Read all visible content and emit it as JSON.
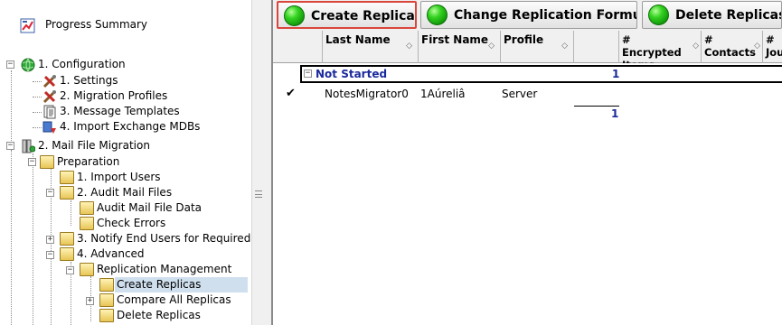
{
  "tree": {
    "progress_summary": "Progress Summary",
    "configuration": "1. Configuration",
    "settings": "1. Settings",
    "migration_profiles": "2. Migration Profiles",
    "message_templates": "3. Message Templates",
    "import_exchange_mdbs": "4. Import Exchange MDBs",
    "mail_file_migration": "2. Mail File Migration",
    "preparation": "Preparation",
    "import_users": "1. Import Users",
    "audit_mail_files": "2. Audit Mail Files",
    "audit_mail_file_data": "Audit Mail File Data",
    "check_errors": "Check Errors",
    "notify_end_users": "3. Notify End Users for Required",
    "advanced": "4. Advanced",
    "replication_management": "Replication Management",
    "create_replicas": "Create Replicas",
    "compare_all_replicas": "Compare All Replicas",
    "delete_replicas": "Delete Replicas"
  },
  "toolbar": {
    "create_replicas": "Create Replicas",
    "change_formula": "Change Replication Formula",
    "delete_replicas": "Delete Replicas"
  },
  "grid": {
    "headers": {
      "last_name": "Last Name",
      "first_name": "First Name",
      "profile": "Profile",
      "encrypted_items": "# Encrypted Items",
      "contacts": "# Contacts",
      "journal": "# Jou"
    },
    "group": {
      "name": "Not Started",
      "count": "1"
    },
    "rows": [
      {
        "checked": "✔",
        "last_name": "NotesMigrator0",
        "first_name": "1Aúreliâ",
        "profile": "Server"
      }
    ],
    "total": "1"
  },
  "colors": {
    "accent_active": "#d9463c",
    "group_text": "#1a2a9c",
    "selection": "#cfdfee"
  },
  "icons": [
    "progress-summary-icon",
    "globe-icon",
    "settings-tools-icon",
    "document-icon",
    "database-import-icon",
    "server-icon",
    "folder-icon",
    "green-orb-icon",
    "sort-icon",
    "expand-icon",
    "collapse-icon"
  ]
}
